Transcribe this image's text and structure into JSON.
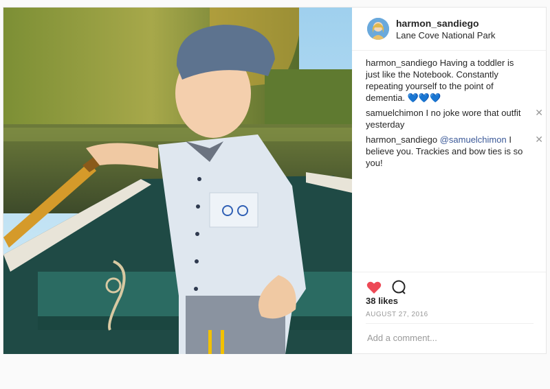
{
  "post": {
    "username": "harmon_sandiego",
    "location": "Lane Cove National Park",
    "likes": "38 likes",
    "date": "AUGUST 27, 2016",
    "comment_placeholder": "Add a comment..."
  },
  "comments": [
    {
      "user": "harmon_sandiego",
      "text": " Having a toddler is just like the Notebook. Constantly repeating yourself to the point of dementia. 💙💙💙"
    },
    {
      "user": "samuelchimon",
      "text": " I no joke wore that outfit yesterday"
    },
    {
      "user": "harmon_sandiego",
      "mention": "@samuelchimon",
      "text": " I believe you. Trackies and bow ties is so you!"
    }
  ],
  "icons": {
    "like": "heart-icon",
    "comment": "speech-bubble-icon",
    "delete": "close-icon"
  },
  "colors": {
    "heart": "#ed4956",
    "mention": "#3b5998",
    "muted": "#999999"
  }
}
